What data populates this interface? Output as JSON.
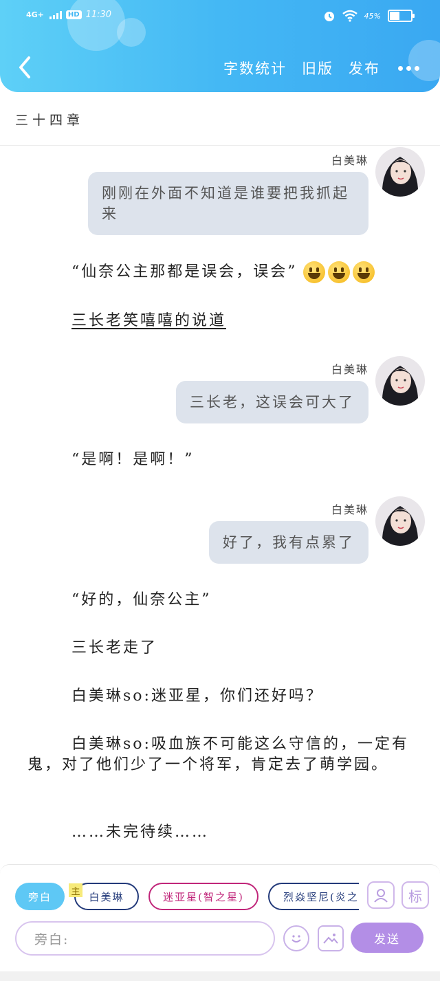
{
  "status_bar": {
    "network": "4G+",
    "hd": "HD",
    "time": "11:30",
    "battery": "45%",
    "battery_level": 0.45
  },
  "header": {
    "actions": [
      "字数统计",
      "旧版",
      "发布"
    ]
  },
  "chapter": {
    "title": "三十四章"
  },
  "messages": [
    {
      "speaker": "白美琳",
      "text": "刚刚在外面不知道是谁要把我抓起来"
    },
    {
      "speaker": "白美琳",
      "text": "三长老，这误会可大了"
    },
    {
      "speaker": "白美琳",
      "text": "好了，我有点累了"
    }
  ],
  "narration": [
    "“仙奈公主那都是误会，误会”",
    "三长老笑嘻嘻的说道",
    "“是啊！是啊！”",
    "“好的，仙奈公主”",
    "三长老走了",
    "白美琳so:迷亚星，你们还好吗？",
    "白美琳so:吸血族不可能这么守信的，一定有鬼，对了他们少了一个将军，肯定去了萌学园。",
    "……未完待续……"
  ],
  "emoji": [
    "grinning-face",
    "grinning-face",
    "grinning-face"
  ],
  "bottom": {
    "roles": [
      {
        "label": "旁白",
        "active": true
      },
      {
        "label": "白美琳",
        "tag": "主"
      },
      {
        "label": "迷亚星(智之星)"
      },
      {
        "label": "烈焱坚尼(炎之"
      }
    ],
    "icons": {
      "role_icon": "user-portrait-icon",
      "tag_icon": "标"
    },
    "input_placeholder": "旁白:",
    "send_label": "发送"
  },
  "colors": {
    "header_gradient_start": "#5ed0f7",
    "header_gradient_end": "#3aa8f2",
    "bubble_bg": "#dde3ec",
    "send_btn": "#b38ee6",
    "active_chip": "#5ec8f5"
  }
}
